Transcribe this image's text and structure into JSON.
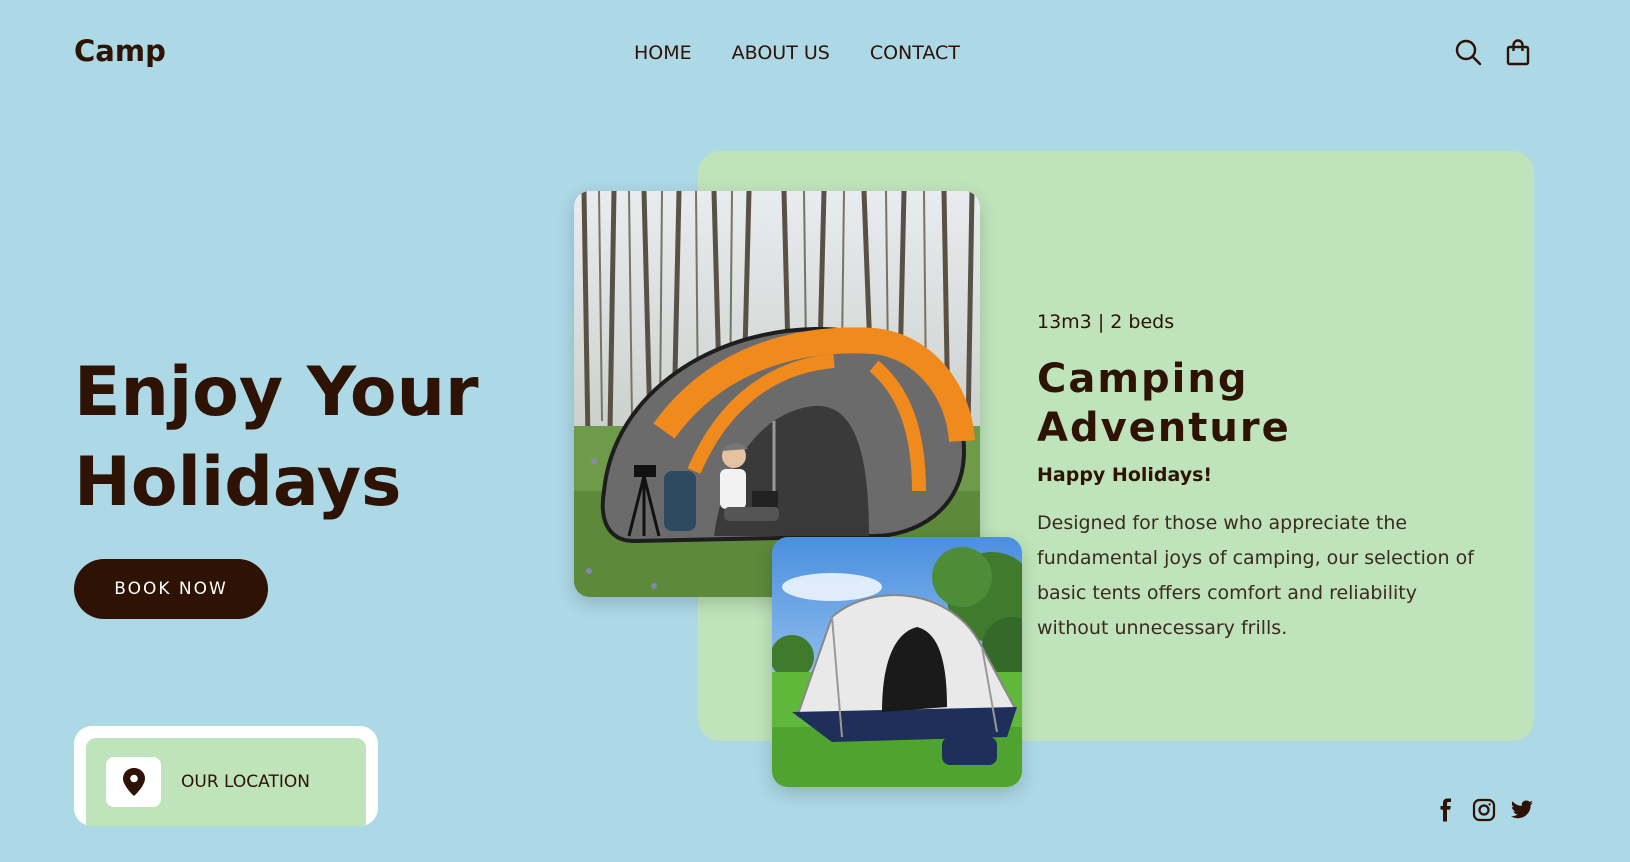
{
  "header": {
    "brand": "Camp",
    "nav": [
      "HOME",
      "ABOUT US",
      "CONTACT"
    ],
    "icons": [
      "search-icon",
      "shopping-bag-icon"
    ]
  },
  "hero": {
    "title_line1": "Enjoy Your",
    "title_line2": "Holidays",
    "cta_label": "BOOK NOW"
  },
  "location": {
    "icon": "map-pin-icon",
    "label": "OUR LOCATION"
  },
  "feature": {
    "spec": "13m3 | 2 beds",
    "title": "Camping Adventure",
    "subtitle": "Happy Holidays!",
    "description": "Designed for those who appreciate the fundamental joys of camping, our selection of basic tents offers comfort and reliability without unnecessary frills.",
    "images": [
      "orange-pop-up-tent-photo",
      "navy-dome-tent-photo"
    ]
  },
  "social": [
    "facebook-icon",
    "instagram-icon",
    "twitter-icon"
  ],
  "colors": {
    "background": "#add8e6",
    "card": "#bfe4bb",
    "primary": "#2e1204"
  }
}
